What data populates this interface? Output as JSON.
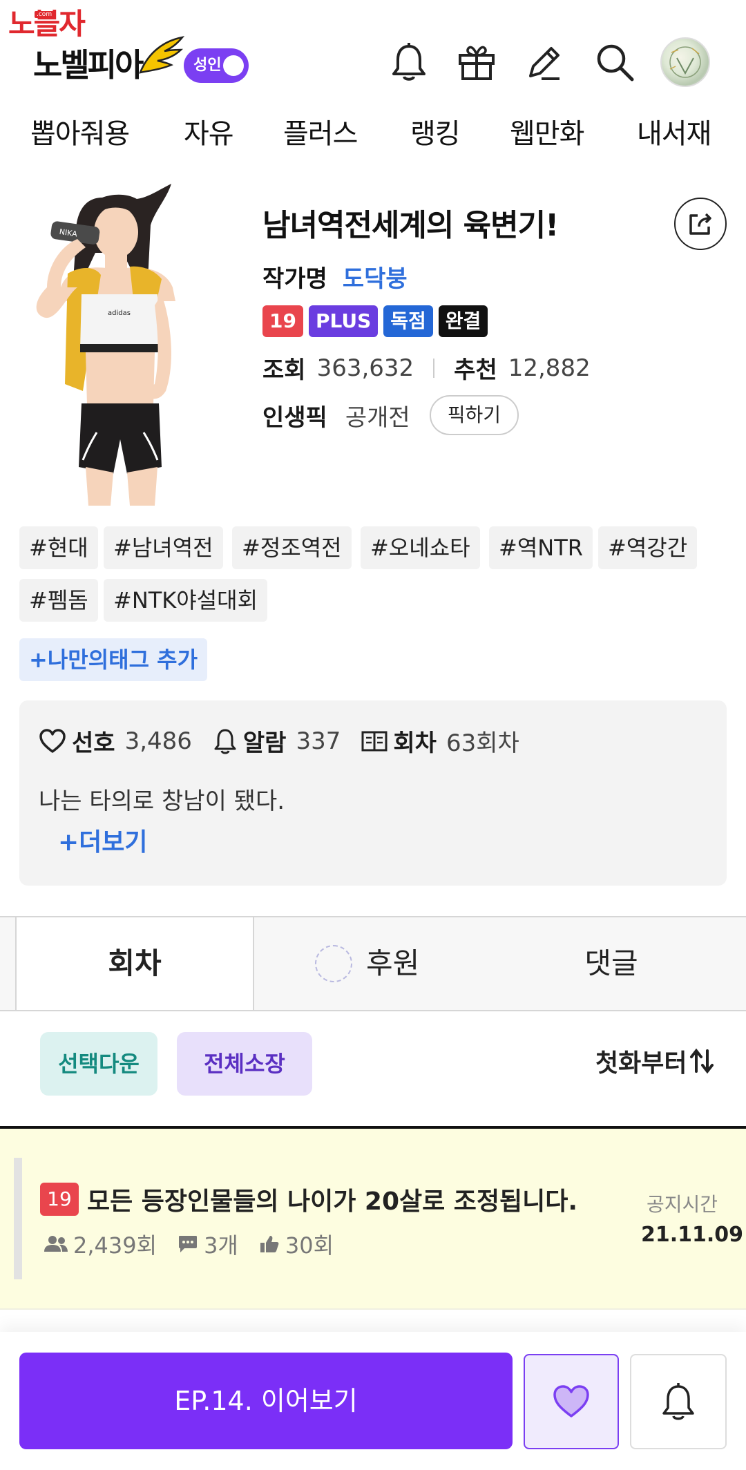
{
  "watermark": {
    "text": "노블자",
    "url": ".com"
  },
  "header": {
    "logo_text": "노벨피아",
    "adult_label": "성인",
    "icons": [
      "bell-icon",
      "gift-icon",
      "pencil-icon",
      "search-icon"
    ]
  },
  "nav": {
    "items": [
      {
        "label": "뽑아줘용"
      },
      {
        "label": "자유"
      },
      {
        "label": "플러스"
      },
      {
        "label": "랭킹"
      },
      {
        "label": "웹만화"
      },
      {
        "label": "내서재"
      }
    ]
  },
  "novel": {
    "title": "남녀역전세계의 육변기!",
    "author_label": "작가명",
    "author_name": "도닥붕",
    "badges": [
      {
        "text": "19",
        "color": "#e9454d"
      },
      {
        "text": "PLUS",
        "color": "#6a3de0"
      },
      {
        "text": "독점",
        "color": "#2467d6"
      },
      {
        "text": "완결",
        "color": "#111111"
      }
    ],
    "views_label": "조회",
    "views_value": "363,632",
    "recommend_label": "추천",
    "recommend_value": "12,882",
    "pick_label": "인생픽",
    "pick_value": "공개전",
    "pick_button": "픽하기"
  },
  "tags": [
    "#현대",
    "#남녀역전",
    "#정조역전",
    "#오네쇼타",
    "#역NTR",
    "#역강간",
    "#펨돔",
    "#NTK야설대회"
  ],
  "tag_add": "+나만의태그 추가",
  "info": {
    "like_label": "선호",
    "like_value": "3,486",
    "alarm_label": "알람",
    "alarm_value": "337",
    "episode_label": "회차",
    "episode_value": "63회차",
    "description": "나는 타의로 창남이 됐다.",
    "more": "+더보기"
  },
  "tabs": [
    {
      "label": "회차",
      "active": true
    },
    {
      "label": "후원",
      "active": false
    },
    {
      "label": "댓글",
      "active": false
    }
  ],
  "actions": {
    "select_download": "선택다운",
    "save_all": "전체소장",
    "sort": "첫화부터"
  },
  "notice": {
    "age": "19",
    "title": "모든 등장인물들의 나이가 20살로 조정됩니다.",
    "views": "2,439회",
    "comments": "3개",
    "likes": "30회",
    "time_label": "공지시간",
    "time_value": "21.11.09"
  },
  "bottom": {
    "continue_label": "EP.14. 이어보기"
  },
  "colors": {
    "accent": "#7b2ff7",
    "link": "#2f6fdc",
    "notice_bg": "#fdfde0"
  }
}
